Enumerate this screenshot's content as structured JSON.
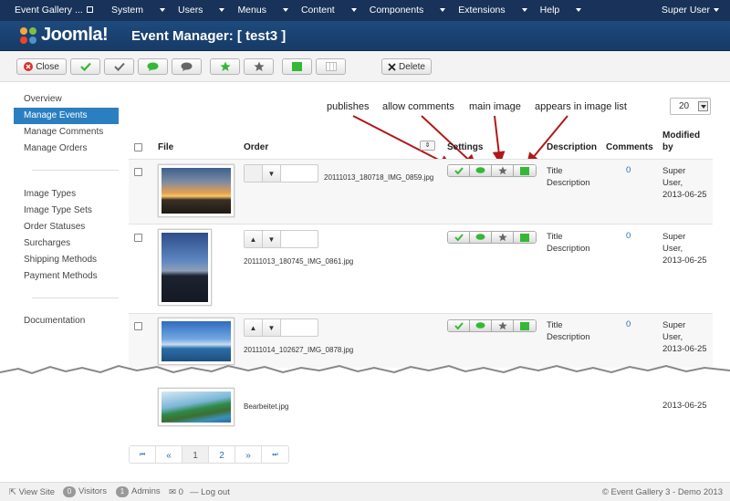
{
  "topnav": {
    "brand": "Event Gallery ...",
    "menu": [
      "System",
      "Users",
      "Menus",
      "Content",
      "Components",
      "Extensions",
      "Help"
    ],
    "user": "Super User"
  },
  "header": {
    "logo": "Joomla!",
    "title": "Event Manager: [ test3 ]"
  },
  "toolbar": {
    "close": "Close",
    "delete": "Delete"
  },
  "sidebar": {
    "group1": [
      "Overview",
      "Manage Events",
      "Manage Comments",
      "Manage Orders"
    ],
    "group2": [
      "Image Types",
      "Image Type Sets",
      "Order Statuses",
      "Surcharges",
      "Shipping Methods",
      "Payment Methods"
    ],
    "group3": [
      "Documentation"
    ]
  },
  "callouts": {
    "publishes": "publishes",
    "allow_comments": "allow comments",
    "main_image": "main image",
    "appears_in_list": "appears in image list"
  },
  "limit": "20",
  "columns": {
    "file": "File",
    "order": "Order",
    "settings": "Settings",
    "description": "Description",
    "comments": "Comments",
    "modified": "Modified by"
  },
  "rows": [
    {
      "file": "20111013_180718_IMG_0859.jpg",
      "desc1": "Title",
      "desc2": "Description",
      "comments": "0",
      "mod1": "Super",
      "mod2": "User,",
      "mod3": "2013-06-25"
    },
    {
      "file": "20111013_180745_IMG_0861.jpg",
      "desc1": "Title",
      "desc2": "Description",
      "comments": "0",
      "mod1": "Super",
      "mod2": "User,",
      "mod3": "2013-06-25"
    },
    {
      "file": "20111014_102627_IMG_0878.jpg",
      "desc1": "Title",
      "desc2": "Description",
      "comments": "0",
      "mod1": "Super",
      "mod2": "User,",
      "mod3": "2013-06-25"
    },
    {
      "file": "Bearbeitet.jpg",
      "mod3": "2013-06-25"
    }
  ],
  "pagination": {
    "first": "⏮",
    "prev": "«",
    "p1": "1",
    "p2": "2",
    "next": "»",
    "last": "⏭"
  },
  "status": {
    "view_site": "View Site",
    "visitors_count": "0",
    "visitors": "Visitors",
    "admins_count": "1",
    "admins": "Admins",
    "messages": "0",
    "logout": "Log out",
    "copyright": "© Event Gallery 3 - Demo 2013"
  },
  "colors": {
    "nav": "#183259",
    "header": "#1e4a7e",
    "active": "#2b7fc1",
    "green": "#35b835",
    "arrow": "#b01818"
  }
}
